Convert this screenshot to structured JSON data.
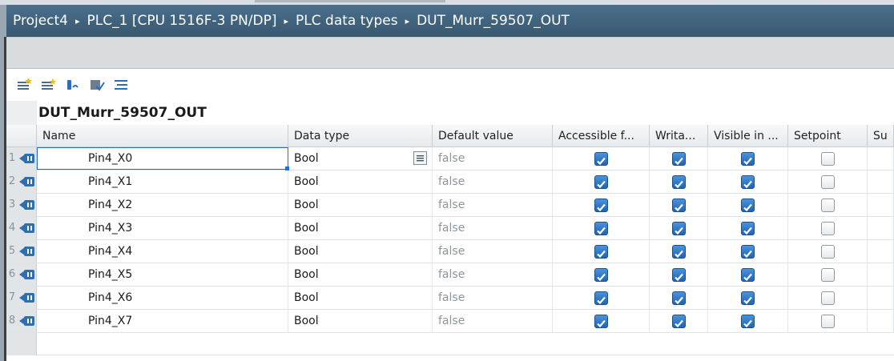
{
  "breadcrumb": {
    "items": [
      "Project4",
      "PLC_1 [CPU 1516F-3 PN/DP]",
      "PLC data types",
      "DUT_Murr_59507_OUT"
    ],
    "separator": "▸"
  },
  "toolbar": {
    "buttons": [
      "insert-row-icon",
      "add-row-icon",
      "reset-start-values-icon",
      "expand-icon",
      "show-all-icon"
    ]
  },
  "type_title": "DUT_Murr_59507_OUT",
  "table": {
    "headers": [
      "Name",
      "Data type",
      "Default value",
      "Accessible f...",
      "Writa...",
      "Visible in ...",
      "Setpoint",
      "Su"
    ],
    "rows": [
      {
        "num": "1",
        "name": "Pin4_X0",
        "dtype": "Bool",
        "default": "false",
        "accessible": true,
        "writable": true,
        "visible": true,
        "setpoint": false
      },
      {
        "num": "2",
        "name": "Pin4_X1",
        "dtype": "Bool",
        "default": "false",
        "accessible": true,
        "writable": true,
        "visible": true,
        "setpoint": false
      },
      {
        "num": "3",
        "name": "Pin4_X2",
        "dtype": "Bool",
        "default": "false",
        "accessible": true,
        "writable": true,
        "visible": true,
        "setpoint": false
      },
      {
        "num": "4",
        "name": "Pin4_X3",
        "dtype": "Bool",
        "default": "false",
        "accessible": true,
        "writable": true,
        "visible": true,
        "setpoint": false
      },
      {
        "num": "5",
        "name": "Pin4_X4",
        "dtype": "Bool",
        "default": "false",
        "accessible": true,
        "writable": true,
        "visible": true,
        "setpoint": false
      },
      {
        "num": "6",
        "name": "Pin4_X5",
        "dtype": "Bool",
        "default": "false",
        "accessible": true,
        "writable": true,
        "visible": true,
        "setpoint": false
      },
      {
        "num": "7",
        "name": "Pin4_X6",
        "dtype": "Bool",
        "default": "false",
        "accessible": true,
        "writable": true,
        "visible": true,
        "setpoint": false
      },
      {
        "num": "8",
        "name": "Pin4_X7",
        "dtype": "Bool",
        "default": "false",
        "accessible": true,
        "writable": true,
        "visible": true,
        "setpoint": false
      }
    ]
  },
  "colors": {
    "breadcrumb_bg": "#3f6580",
    "selection": "#2a6ccd",
    "checkbox_on": "#2f78c8"
  }
}
